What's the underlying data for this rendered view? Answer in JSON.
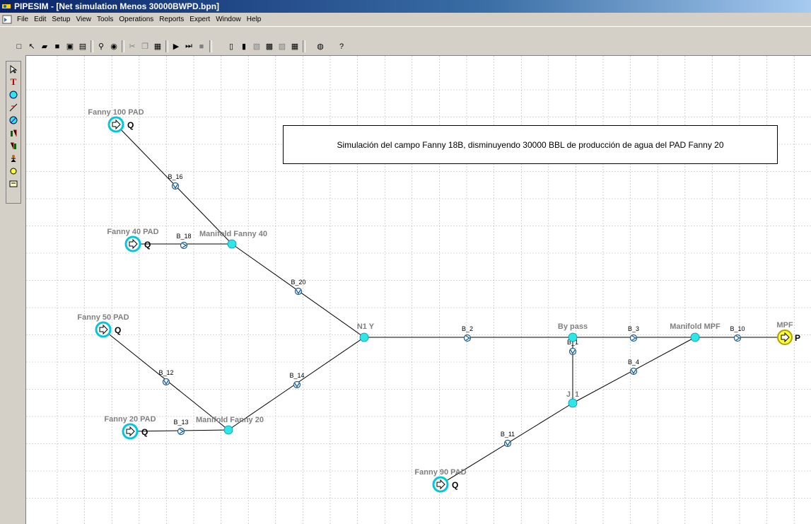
{
  "window": {
    "title": "PIPESIM - [Net simulation Menos 30000BWPD.bpn]"
  },
  "menu": [
    "File",
    "Edit",
    "Setup",
    "View",
    "Tools",
    "Operations",
    "Reports",
    "Expert",
    "Window",
    "Help"
  ],
  "note": "Simulación del campo Fanny 18B, disminuyendo 30000 BBL de producción de agua del PAD Fanny 20",
  "sources": [
    {
      "name": "Fanny 100 PAD",
      "tag": "Q"
    },
    {
      "name": "Fanny 40 PAD",
      "tag": "Q"
    },
    {
      "name": "Fanny 50 PAD",
      "tag": "Q"
    },
    {
      "name": "Fanny 20 PAD",
      "tag": "Q"
    },
    {
      "name": "Fanny 90 PAD",
      "tag": "Q"
    }
  ],
  "sink": {
    "name": "MPF",
    "tag": "P"
  },
  "junctions": [
    "Manifold Fanny 40",
    "N1 Y",
    "Manifold Fanny 20",
    "By pass",
    "Manifold MPF",
    "J_1"
  ],
  "branches": [
    "B_16",
    "B_18",
    "B_20",
    "B_12",
    "B_13",
    "B_14",
    "B_2",
    "B_3",
    "B_10",
    "B_1",
    "B_4",
    "B_11"
  ],
  "colors": {
    "junction": "#2ee6e6",
    "source_ring": "#00c8d8",
    "sink": "#ffff33",
    "label_gray": "#808080",
    "grid": "#b4b4b4"
  }
}
